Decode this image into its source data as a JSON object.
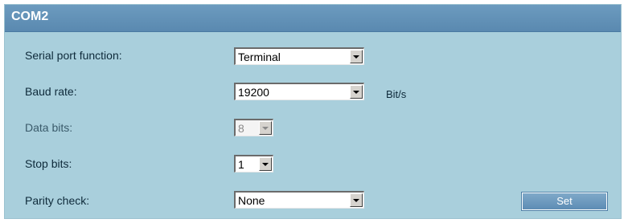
{
  "panel": {
    "title": "COM2"
  },
  "fields": {
    "serial_port_function": {
      "label": "Serial port function:",
      "value": "Terminal"
    },
    "baud_rate": {
      "label": "Baud rate:",
      "value": "19200",
      "unit": "Bit/s"
    },
    "data_bits": {
      "label": "Data bits:",
      "value": "8"
    },
    "stop_bits": {
      "label": "Stop bits:",
      "value": "1"
    },
    "parity_check": {
      "label": "Parity check:",
      "value": "None"
    }
  },
  "actions": {
    "set_label": "Set"
  },
  "colors": {
    "panel_background": "#a9cfdc",
    "header_background": "#6c9bbf",
    "button_background": "#6f9bc0"
  }
}
